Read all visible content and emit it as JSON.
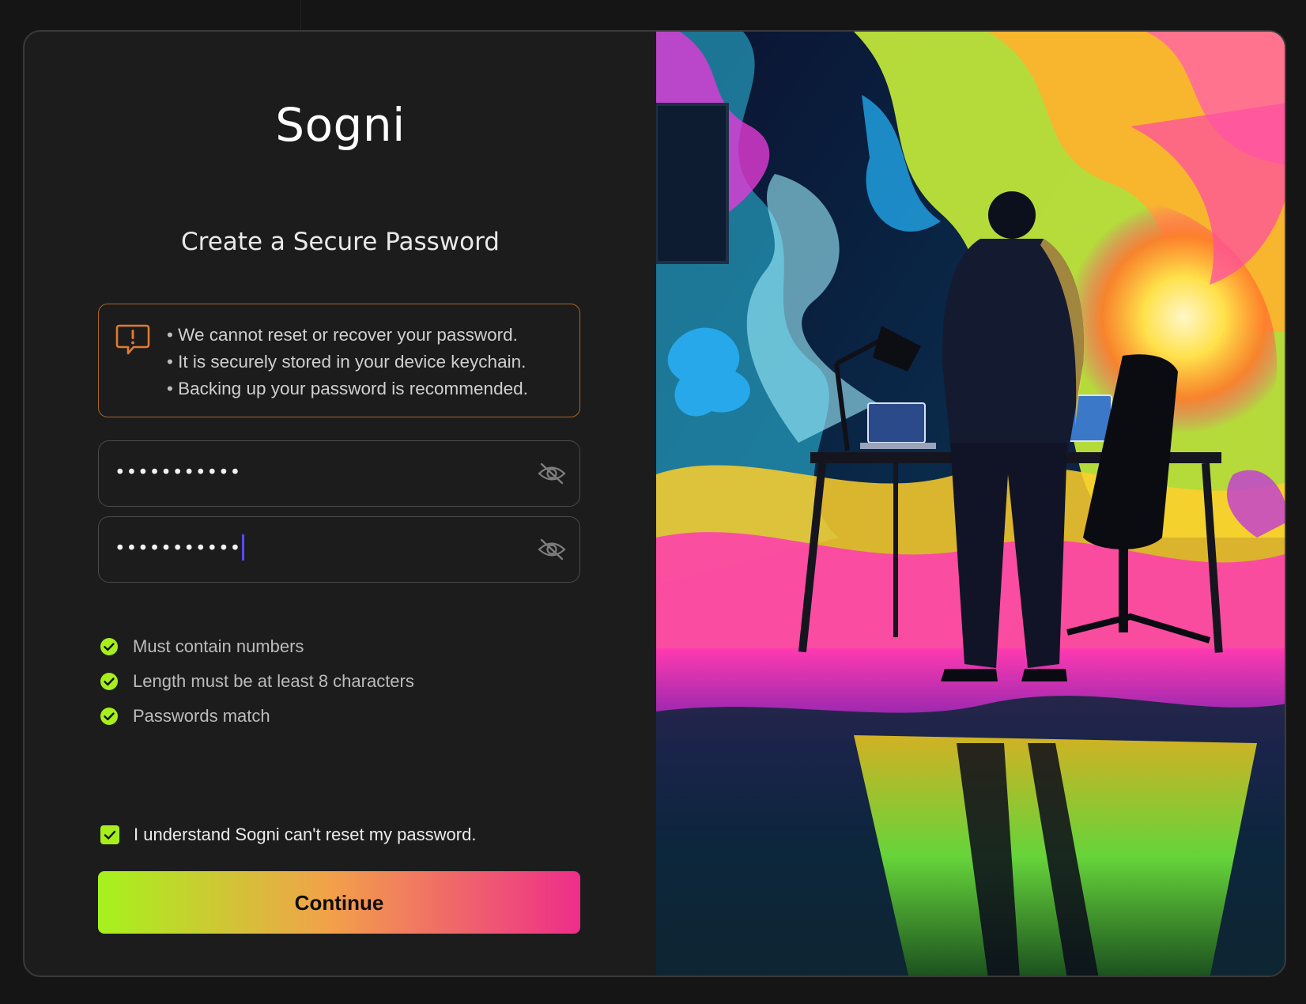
{
  "app": {
    "logo_text": "Sogni",
    "subtitle": "Create a Secure Password"
  },
  "notice": {
    "icon": "alert-speech-bubble-icon",
    "border_color": "#a8662b",
    "items": [
      "We cannot reset or recover your password.",
      "It is securely stored in your device keychain.",
      "Backing up your password is recommended."
    ]
  },
  "password_fields": [
    {
      "value": "•••••••••••",
      "toggle_icon": "eye-slash-icon",
      "focused": false
    },
    {
      "value": "•••••••••••",
      "toggle_icon": "eye-slash-icon",
      "focused": true
    }
  ],
  "requirements": [
    {
      "label": "Must contain numbers",
      "met": true
    },
    {
      "label": "Length must be at least 8 characters",
      "met": true
    },
    {
      "label": "Passwords match",
      "met": true
    }
  ],
  "acknowledgement": {
    "label": "I understand Sogni can't reset my password.",
    "checked": true
  },
  "continue_button": {
    "label": "Continue"
  },
  "colors": {
    "accent_green": "#a6ef1d",
    "accent_orange": "#f2a14a",
    "accent_pink": "#ee2d8a",
    "caret": "#5b4bff"
  }
}
